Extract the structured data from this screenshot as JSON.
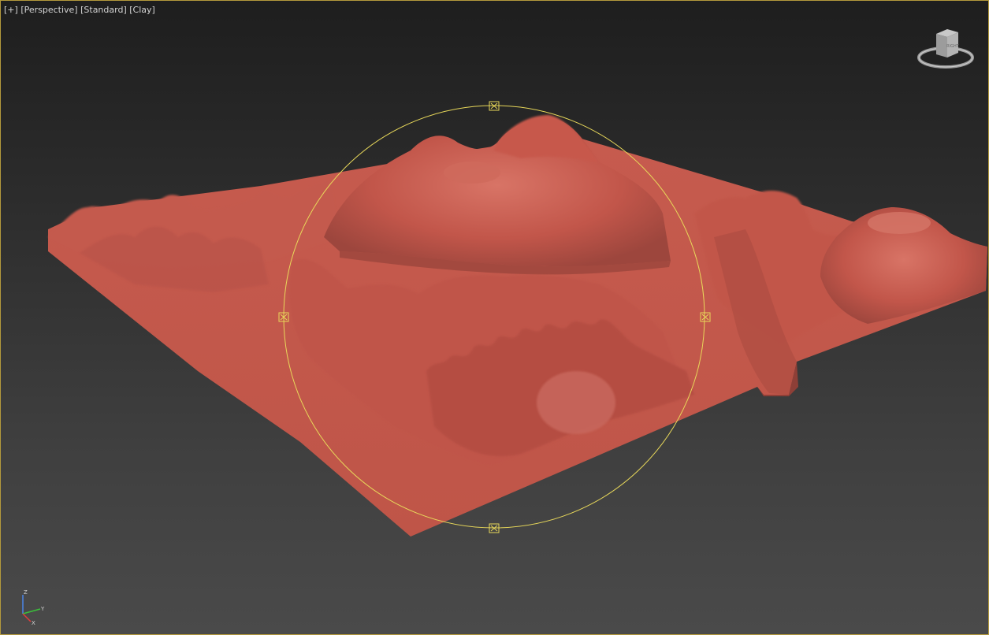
{
  "viewport": {
    "menu_label": "[+]",
    "view_label": "[Perspective]",
    "shading_label": "[Standard]",
    "render_mode_label": "[Clay]"
  },
  "viewcube": {
    "icon": "viewcube-icon",
    "face_label": "RIGHT"
  },
  "axis_gizmo": {
    "z_label": "Z",
    "x_label": "X",
    "y_label": "Y"
  },
  "colors": {
    "terrain": "#c2564a",
    "terrain_dark": "#8e3f37",
    "terrain_light": "#d46f62",
    "selection_gizmo": "#e8d85a",
    "viewport_border": "#b49a3c"
  }
}
